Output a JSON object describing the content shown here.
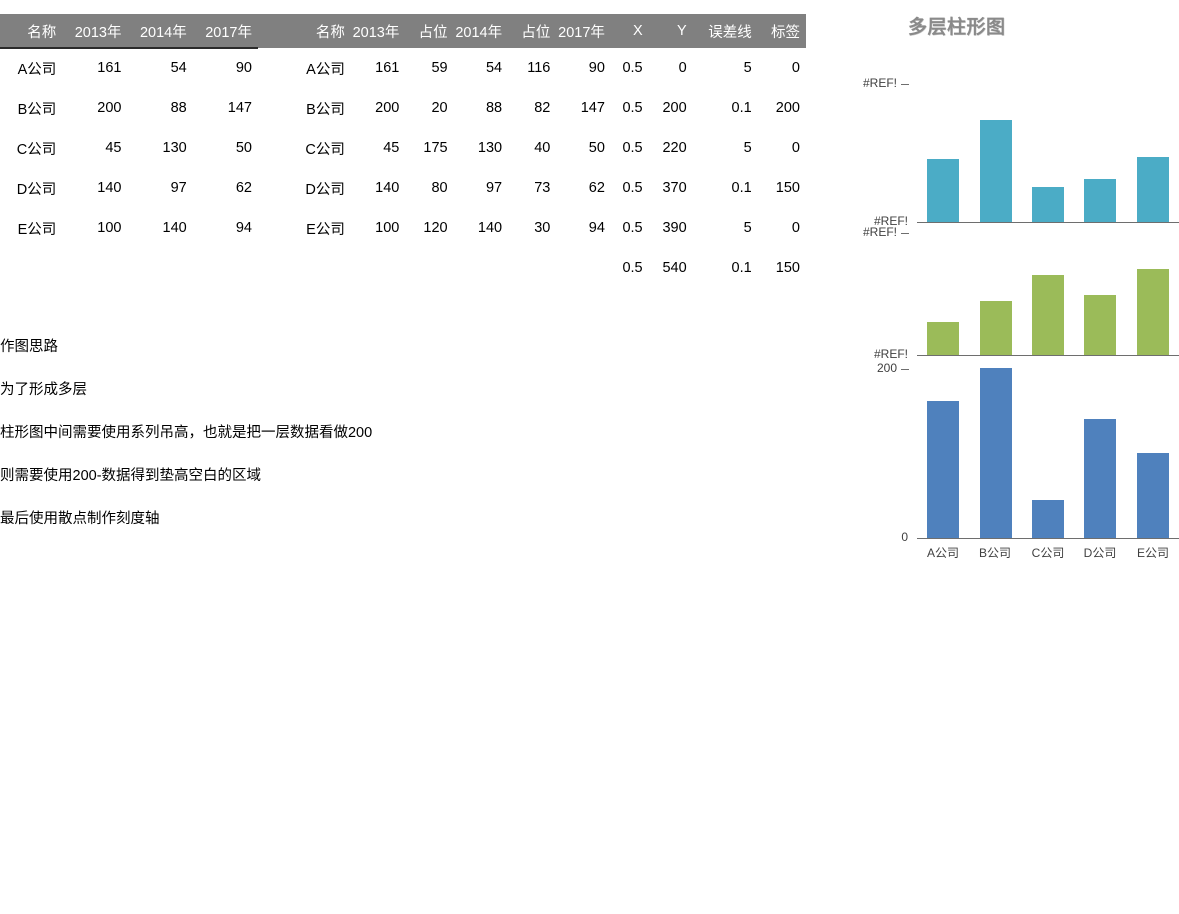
{
  "tables": {
    "table_one": {
      "headers": [
        "名称",
        "2013年",
        "2014年",
        "2017年"
      ],
      "rows": [
        [
          "A公司",
          "161",
          "54",
          "90"
        ],
        [
          "B公司",
          "200",
          "88",
          "147"
        ],
        [
          "C公司",
          "45",
          "130",
          "50"
        ],
        [
          "D公司",
          "140",
          "97",
          "62"
        ],
        [
          "E公司",
          "100",
          "140",
          "94"
        ]
      ]
    },
    "table_two": {
      "headers": [
        "名称",
        "2013年",
        "占位",
        "2014年",
        "占位",
        "2017年",
        "X",
        "Y",
        "误差线",
        "标签"
      ],
      "rows": [
        [
          "A公司",
          "161",
          "59",
          "54",
          "116",
          "90",
          "0.5",
          "0",
          "5",
          "0"
        ],
        [
          "B公司",
          "200",
          "20",
          "88",
          "82",
          "147",
          "0.5",
          "200",
          "0.1",
          "200"
        ],
        [
          "C公司",
          "45",
          "175",
          "130",
          "40",
          "50",
          "0.5",
          "220",
          "5",
          "0"
        ],
        [
          "D公司",
          "140",
          "80",
          "97",
          "73",
          "62",
          "0.5",
          "370",
          "0.1",
          "150"
        ],
        [
          "E公司",
          "100",
          "120",
          "140",
          "30",
          "94",
          "0.5",
          "390",
          "5",
          "0"
        ],
        [
          "",
          "",
          "",
          "",
          "",
          "",
          "0.5",
          "540",
          "0.1",
          "150"
        ]
      ]
    }
  },
  "notes": {
    "title": "作图思路",
    "lines": [
      "为了形成多层",
      "柱形图中间需要使用系列吊高，也就是把一层数据看做200",
      "则需要使用200-数据得到垫高空白的区域",
      "最后使用散点制作刻度轴"
    ]
  },
  "chart_data": {
    "type": "bar",
    "title": "多层柱形图",
    "categories": [
      "A公司",
      "B公司",
      "C公司",
      "D公司",
      "E公司"
    ],
    "series": [
      {
        "name": "2017年",
        "values": [
          90,
          147,
          50,
          62,
          94
        ],
        "color": "#4BACC6",
        "panel": "top"
      },
      {
        "name": "2014年",
        "values": [
          54,
          88,
          130,
          97,
          140
        ],
        "color": "#9BBB59",
        "panel": "middle"
      },
      {
        "name": "2013年",
        "values": [
          161,
          200,
          45,
          140,
          100
        ],
        "color": "#4F81BD",
        "panel": "bottom"
      }
    ],
    "panels": [
      {
        "name": "top",
        "axis_top_label": "#REF!",
        "axis_bottom_label": "#REF!",
        "ylim": [
          0,
          200
        ]
      },
      {
        "name": "middle",
        "axis_top_label": "#REF!",
        "axis_bottom_label": "#REF!",
        "ylim": [
          0,
          200
        ]
      },
      {
        "name": "bottom",
        "axis_top_label": "200",
        "axis_bottom_label": "0",
        "ylim": [
          0,
          200
        ]
      }
    ],
    "xlabel": "",
    "ylabel": "",
    "grid": false,
    "legend": "none",
    "colors": {
      "top_series": "#4BACC6",
      "middle_series": "#9BBB59",
      "bottom_series": "#4F81BD",
      "header_background": "#808080",
      "title_color": "#8A8A8A"
    }
  }
}
